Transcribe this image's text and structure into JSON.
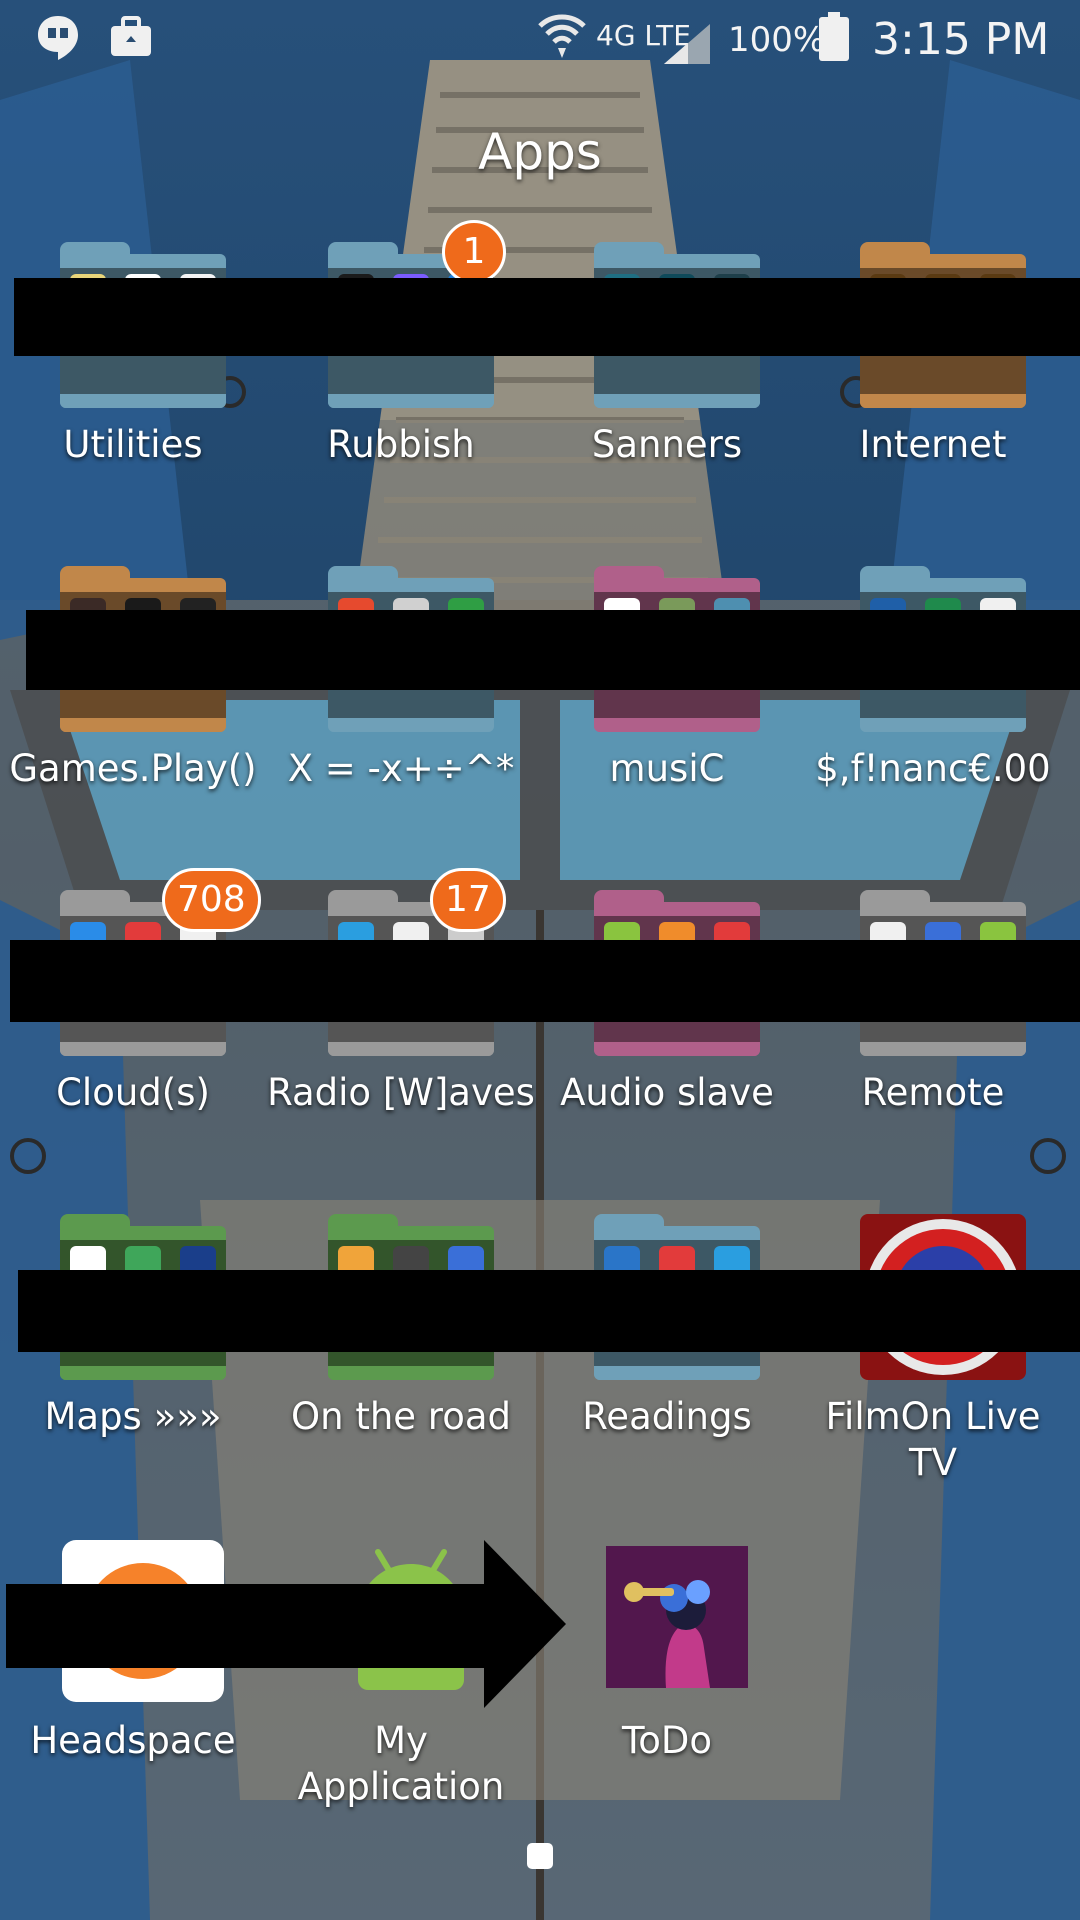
{
  "status_bar": {
    "network_label": "4G LTE",
    "battery_percent": "100%",
    "time": "3:15 PM",
    "icons": [
      "hangouts-icon",
      "briefcase-icon",
      "wifi-icon",
      "signal-icon",
      "battery-icon"
    ]
  },
  "page": {
    "title": "Apps"
  },
  "apps": [
    {
      "label": "Utilities",
      "kind": "folder",
      "color": "#6fa0b8"
    },
    {
      "label": "Rubbish",
      "kind": "folder",
      "color": "#6fa0b8",
      "badge": "1"
    },
    {
      "label": "Sanners",
      "kind": "folder",
      "color": "#6fa0b8"
    },
    {
      "label": "Internet",
      "kind": "folder",
      "color": "#c1874a"
    },
    {
      "label": "Games.Play()",
      "kind": "folder",
      "color": "#c1874a"
    },
    {
      "label": "X = -x+÷^*",
      "kind": "folder",
      "color": "#6fa0b8"
    },
    {
      "label": "musiC",
      "kind": "folder",
      "color": "#b0608a"
    },
    {
      "label": "$,f!nanc€.00",
      "kind": "folder",
      "color": "#6fa0b8"
    },
    {
      "label": "Cloud(s)",
      "kind": "folder",
      "color": "#9a9a9a",
      "badge": "708"
    },
    {
      "label": "Radio [W]aves",
      "kind": "folder",
      "color": "#9a9a9a",
      "badge": "17"
    },
    {
      "label": "Audio slave",
      "kind": "folder",
      "color": "#b0608a"
    },
    {
      "label": "Remote",
      "kind": "folder",
      "color": "#9a9a9a"
    },
    {
      "label": "Maps »»»",
      "kind": "folder",
      "color": "#5c9a4e"
    },
    {
      "label": "On the road",
      "kind": "folder",
      "color": "#5c9a4e"
    },
    {
      "label": "Readings",
      "kind": "folder",
      "color": "#6fa0b8"
    },
    {
      "label": "FilmOn Live\nTV",
      "kind": "app",
      "icon": "filmon-icon"
    },
    {
      "label": "Headspace",
      "kind": "app",
      "icon": "headspace-icon"
    },
    {
      "label": "My\nApplication",
      "kind": "app",
      "icon": "android-icon"
    },
    {
      "label": "ToDo",
      "kind": "app",
      "icon": "todo-icon"
    }
  ],
  "colors": {
    "badge": "#ef6a1b",
    "wallpaper": "#23466a",
    "redaction": "#000000"
  }
}
